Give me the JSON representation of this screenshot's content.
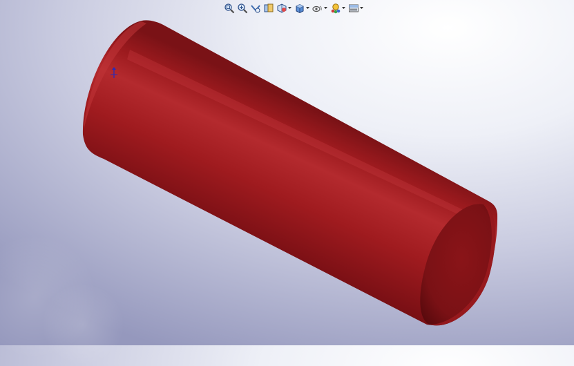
{
  "viewport": {
    "background_top": "#ffffff",
    "background_bottom": "#9598bd",
    "model": {
      "shape": "cylinder",
      "color": "#a01b1f",
      "shadow_color": "#5e0a0e",
      "highlight_color": "#c53a3e",
      "origin_marker_color": "#2a2ab8"
    }
  },
  "toolbar": {
    "buttons": [
      {
        "icon": "zoom-to-fit-icon",
        "has_dropdown": false
      },
      {
        "icon": "zoom-to-area-icon",
        "has_dropdown": false
      },
      {
        "icon": "previous-view-icon",
        "has_dropdown": false
      },
      {
        "icon": "section-view-icon",
        "has_dropdown": false
      },
      {
        "icon": "view-orientation-icon",
        "has_dropdown": true
      },
      {
        "icon": "display-style-icon",
        "has_dropdown": true
      },
      {
        "icon": "hide-show-items-icon",
        "has_dropdown": true
      },
      {
        "icon": "edit-appearance-icon",
        "has_dropdown": true
      },
      {
        "icon": "apply-scene-icon",
        "has_dropdown": true
      }
    ]
  }
}
